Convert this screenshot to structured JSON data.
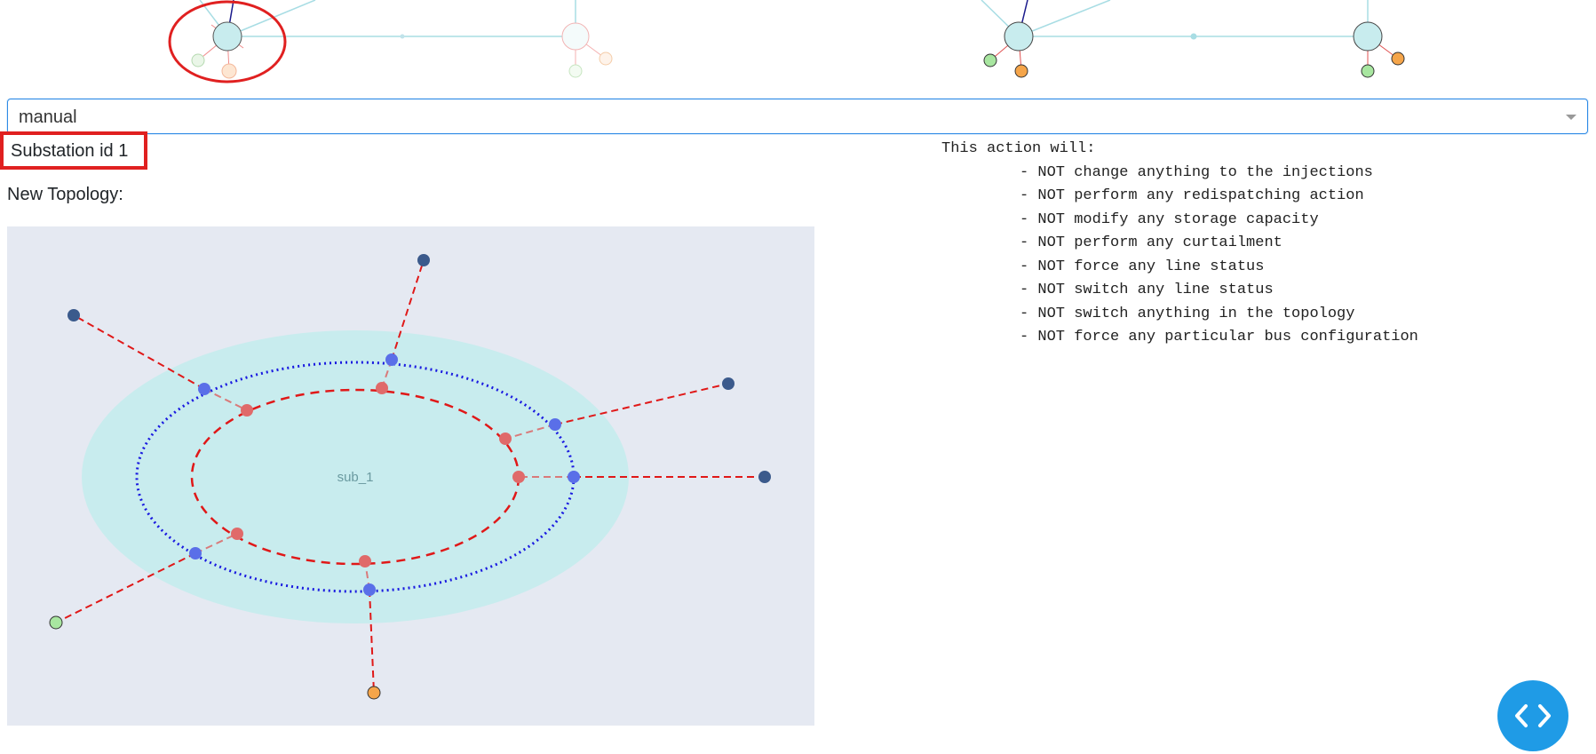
{
  "top_graph": {
    "highlight_color": "#e02020"
  },
  "selector": {
    "value": "manual"
  },
  "substation": {
    "label": "Substation id 1"
  },
  "topology": {
    "title": "New Topology:",
    "substation_label": "sub_1"
  },
  "action": {
    "header": "This action will:",
    "items": [
      "- NOT change anything to the injections",
      "- NOT perform any redispatching action",
      "- NOT modify any storage capacity",
      "- NOT perform any curtailment",
      "- NOT force any line status",
      "- NOT switch any line status",
      "- NOT switch anything in the topology",
      "- NOT force any particular bus configuration"
    ]
  },
  "colors": {
    "accent": "#1f9be6",
    "plot_bg": "#e5e9f2",
    "substation_fill": "#c8ecee",
    "bus1": "#e01818",
    "bus2": "#1a1ae0",
    "line_end": "#3b5a8c",
    "generator": "#a8e6a0",
    "load": "#f5a54a"
  },
  "icons": {
    "code_toggle": "code-brackets-icon"
  }
}
